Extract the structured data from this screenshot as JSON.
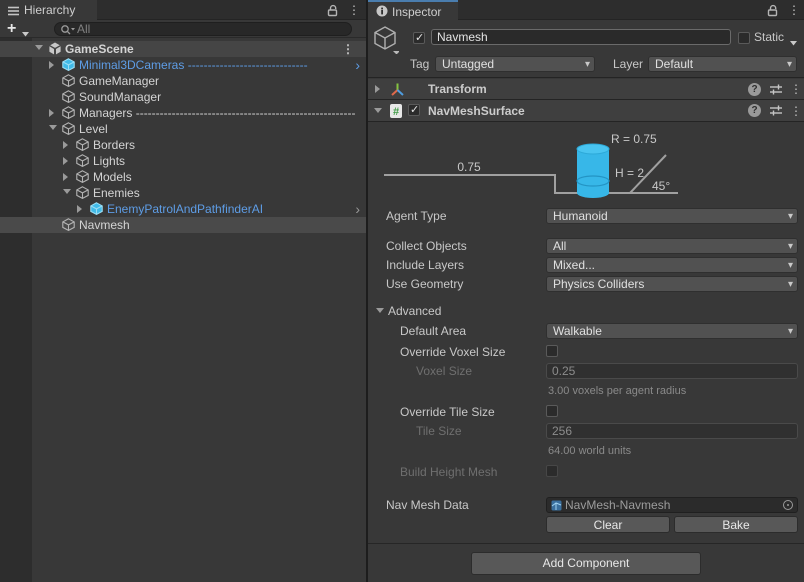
{
  "icons": {
    "kebab": "⋮",
    "chevron": "›",
    "plus": "+",
    "dropdown_caret": "▾",
    "help": "?",
    "info": "i"
  },
  "colors": {
    "accent_tab": "#4a7dae",
    "prefab_text": "#5e9de6",
    "agent_cyan": "#37b7e8",
    "selection": "#4a4a4a",
    "panel_bg": "#383838"
  },
  "hierarchy": {
    "tab_label": "Hierarchy",
    "search_placeholder": "All",
    "rows": [
      {
        "label": "GameScene",
        "depth": 0,
        "icon": "unity-logo",
        "arrow": "expanded",
        "style": "scene-header",
        "trailing": "kebab"
      },
      {
        "label": "Minimal3DCameras",
        "depth": 1,
        "icon": "prefab",
        "arrow": "collapsed",
        "style": "prefab",
        "dashes": "------------------------------",
        "trailing": "chevron-blue"
      },
      {
        "label": "GameManager",
        "depth": 1,
        "icon": "cube"
      },
      {
        "label": "SoundManager",
        "depth": 1,
        "icon": "cube"
      },
      {
        "label": "Managers",
        "depth": 1,
        "icon": "cube",
        "arrow": "collapsed",
        "dashes": "-------------------------------------------------------"
      },
      {
        "label": "Level",
        "depth": 1,
        "icon": "cube",
        "arrow": "expanded"
      },
      {
        "label": "Borders",
        "depth": 2,
        "icon": "cube",
        "arrow": "collapsed"
      },
      {
        "label": "Lights",
        "depth": 2,
        "icon": "cube",
        "arrow": "collapsed"
      },
      {
        "label": "Models",
        "depth": 2,
        "icon": "cube",
        "arrow": "collapsed"
      },
      {
        "label": "Enemies",
        "depth": 2,
        "icon": "cube",
        "arrow": "expanded"
      },
      {
        "label": "EnemyPatrolAndPathfinderAI",
        "depth": 3,
        "icon": "prefab",
        "arrow": "collapsed",
        "style": "prefab",
        "trailing": "chevron-gray"
      },
      {
        "label": "Navmesh",
        "depth": 1,
        "icon": "cube",
        "selected": true
      }
    ]
  },
  "inspector": {
    "tab_label": "Inspector",
    "header": {
      "name": "Navmesh",
      "static_label": "Static",
      "tag_label": "Tag",
      "tag_value": "Untagged",
      "layer_label": "Layer",
      "layer_value": "Default"
    },
    "transform": {
      "title": "Transform"
    },
    "surface": {
      "title": "NavMeshSurface",
      "diagram": {
        "radius_label": "R = 0.75",
        "height_label": "H = 2",
        "step_label": "0.75",
        "slope_label": "45°"
      },
      "agent_type": {
        "label": "Agent Type",
        "value": "Humanoid"
      },
      "collect_objects": {
        "label": "Collect Objects",
        "value": "All"
      },
      "include_layers": {
        "label": "Include Layers",
        "value": "Mixed..."
      },
      "use_geometry": {
        "label": "Use Geometry",
        "value": "Physics Colliders"
      },
      "advanced_label": "Advanced",
      "default_area": {
        "label": "Default Area",
        "value": "Walkable"
      },
      "override_voxel": {
        "label": "Override Voxel Size"
      },
      "voxel_size": {
        "label": "Voxel Size",
        "value": "0.25",
        "helper": "3.00 voxels per agent radius"
      },
      "override_tile": {
        "label": "Override Tile Size"
      },
      "tile_size": {
        "label": "Tile Size",
        "value": "256",
        "helper": "64.00 world units"
      },
      "build_height_mesh": {
        "label": "Build Height Mesh"
      },
      "nav_mesh_data": {
        "label": "Nav Mesh Data",
        "value": "NavMesh-Navmesh"
      },
      "clear_button": "Clear",
      "bake_button": "Bake"
    },
    "add_component_label": "Add Component"
  }
}
